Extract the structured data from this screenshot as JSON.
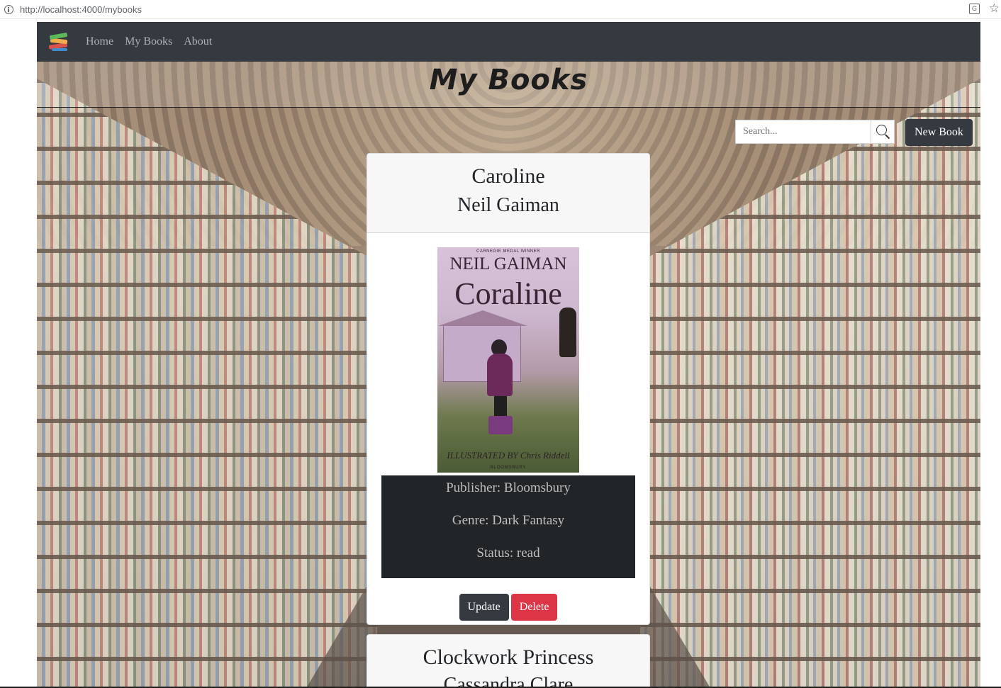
{
  "browser": {
    "url": "http://localhost:4000/mybooks"
  },
  "navbar": {
    "logo_icon": "books-stack-icon",
    "links": [
      {
        "label": "Home"
      },
      {
        "label": "My Books"
      },
      {
        "label": "About"
      }
    ]
  },
  "page": {
    "title": "My Books"
  },
  "search": {
    "placeholder": "Search...",
    "icon": "magnifier-icon"
  },
  "new_book_label": "New Book",
  "books": [
    {
      "title": "Caroline",
      "author": "Neil Gaiman",
      "cover": {
        "top_text": "CARNEGIE MEDAL WINNER",
        "author_text": "NEIL GAIMAN",
        "title_text": "Coraline",
        "illustrator_text": "ILLUSTRATED BY Chris Riddell",
        "publisher_text": "BLOOMSBURY"
      },
      "publisher": "Publisher: Bloomsbury",
      "genre": "Genre: Dark Fantasy",
      "status": "Status: read",
      "update_label": "Update",
      "delete_label": "Delete"
    },
    {
      "title": "Clockwork Princess",
      "author": "Cassandra Clare"
    }
  ],
  "colors": {
    "navbar": "#343a40",
    "danger": "#dc3545",
    "details_bg": "#222528"
  }
}
